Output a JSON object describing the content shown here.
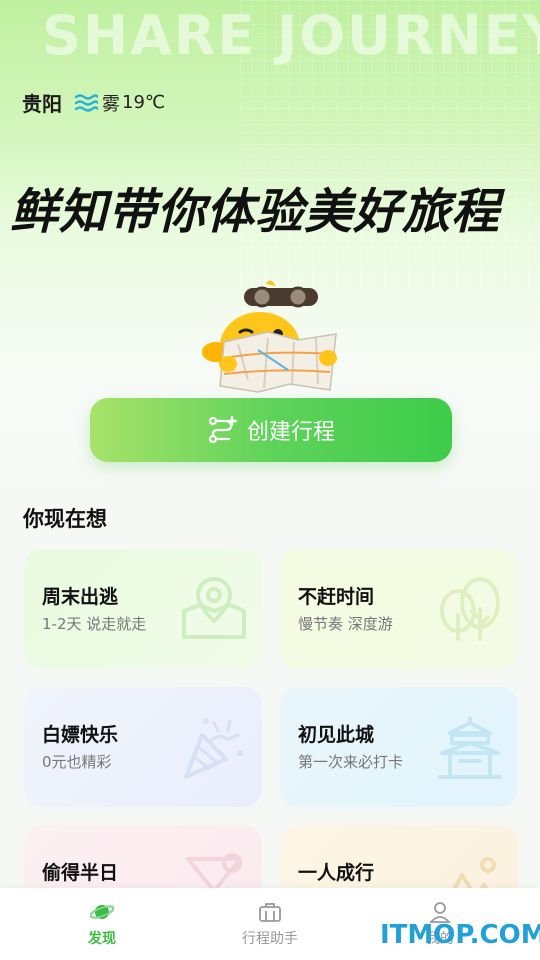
{
  "hero": {
    "bg_text": "SHARE JOURNEY",
    "slogan": "鲜知带你体验美好旅程"
  },
  "weather": {
    "city": "贵阳",
    "icon": "fog-icon",
    "desc": "雾",
    "temp": "19℃"
  },
  "create_button": {
    "label": "创建行程",
    "icon": "route-add-icon"
  },
  "section": {
    "title": "你现在想"
  },
  "cards": [
    {
      "title": "周末出逃",
      "subtitle": "1-2天 说走就走",
      "icon": "map-pin-icon"
    },
    {
      "title": "不赶时间",
      "subtitle": "慢节奏 深度游",
      "icon": "trees-icon"
    },
    {
      "title": "白嫖快乐",
      "subtitle": "0元也精彩",
      "icon": "party-popper-icon"
    },
    {
      "title": "初见此城",
      "subtitle": "第一次来必打卡",
      "icon": "pavilion-icon"
    },
    {
      "title": "偷得半日",
      "subtitle": "",
      "icon": "cocktail-icon"
    },
    {
      "title": "一人成行",
      "subtitle": "",
      "icon": "mountain-icon"
    }
  ],
  "tabbar": {
    "tabs": [
      {
        "label": "发现",
        "icon": "planet-icon",
        "active": true
      },
      {
        "label": "行程助手",
        "icon": "briefcase-icon",
        "active": false
      },
      {
        "label": "我的",
        "icon": "user-icon",
        "active": false
      }
    ]
  },
  "watermark": "ITMOP.COM",
  "colors": {
    "accent": "#3dcc4a",
    "active_tab": "#3dbb45",
    "watermark": "#22a1d8"
  }
}
